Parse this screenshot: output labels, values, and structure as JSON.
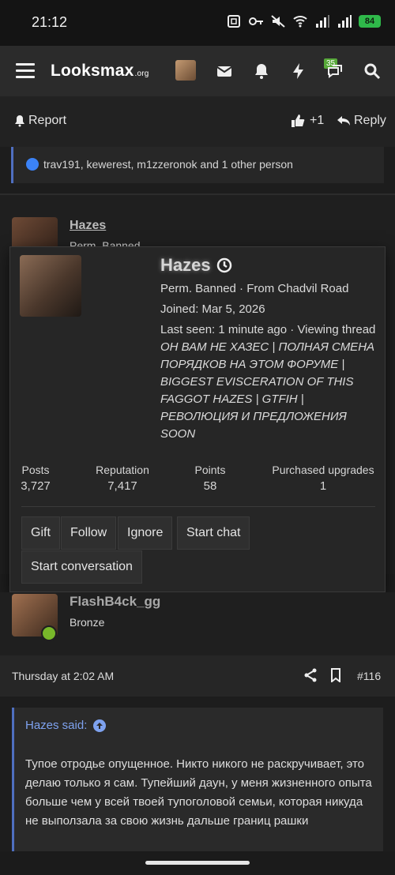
{
  "status_bar": {
    "time": "21:12",
    "battery": "84"
  },
  "navbar": {
    "logo": "Looksmax",
    "logo_suffix": ".org",
    "notification_count": "35"
  },
  "post_actions": {
    "report": "Report",
    "like_count": "+1",
    "reply": "Reply"
  },
  "reactions": {
    "text": "trav191, kewerest, m1zzeronok and 1 other person"
  },
  "background_post": {
    "author": "Hazes",
    "partial_rank": "Perm. Banned"
  },
  "popup": {
    "username": "Hazes",
    "title_line": "Perm. Banned · From Chadvil Road",
    "joined": "Joined: Mar 5, 2026",
    "last_seen_prefix": "Last seen: 1 minute ago · Viewing thread",
    "thread_title": "ОН ВАМ НЕ ХАЗЕС | ПОЛНАЯ СМЕНА ПОРЯДКОВ НА ЭТОМ ФОРУМЕ | BIGGEST EVISCERATION OF THIS FAGGOT HAZES | GTFIH | РЕВОЛЮЦИЯ И ПРЕДЛОЖЕНИЯ SOON",
    "stats": [
      {
        "label": "Posts",
        "value": "3,727"
      },
      {
        "label": "Reputation",
        "value": "7,417"
      },
      {
        "label": "Points",
        "value": "58"
      },
      {
        "label": "Purchased upgrades",
        "value": "1"
      }
    ],
    "buttons": {
      "gift": "Gift",
      "follow": "Follow",
      "ignore": "Ignore",
      "start_chat": "Start chat",
      "start_conversation": "Start conversation"
    }
  },
  "post2": {
    "author": "FlashB4ck_gg",
    "rank": "Bronze",
    "date": "Thursday at 2:02 AM",
    "number": "#116"
  },
  "quote": {
    "header": "Hazes said:",
    "body": "Тупое отродье опущенное. Никто никого не раскручивает, это делаю только я сам. Тупейший даун, у меня жизненного опыта больше чем у всей твоей тупоголовой семьи, которая никуда не выползала за свою жизнь дальше границ рашки"
  },
  "colors": {
    "accent": "#4f6fc0",
    "link": "#7ea2ef",
    "online": "#78b82a",
    "badge": "#57a839"
  }
}
